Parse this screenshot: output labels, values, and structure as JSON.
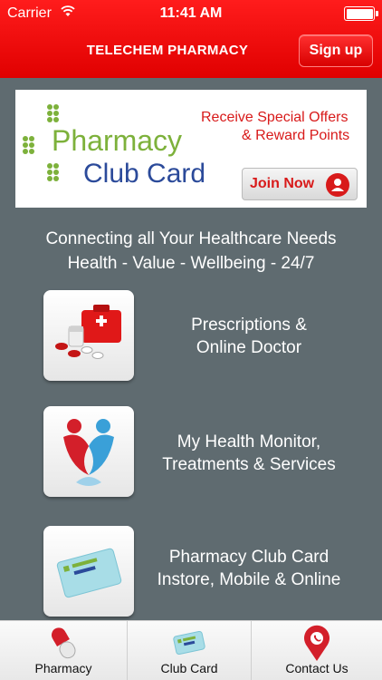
{
  "status_bar": {
    "carrier": "Carrier",
    "time": "11:41 AM"
  },
  "header": {
    "title": "TELECHEM PHARMACY",
    "signup_label": "Sign up"
  },
  "banner": {
    "brand_line1": "Pharmacy",
    "brand_line2": "Club Card",
    "offer_line1": "Receive Special Offers",
    "offer_line2": "& Reward Points",
    "join_label": "Join Now"
  },
  "tagline": {
    "line1": "Connecting all Your Healthcare Needs",
    "line2": "Health - Value - Wellbeing - 24/7"
  },
  "menu": [
    {
      "line1": "Prescriptions &",
      "line2": "Online Doctor",
      "icon": "first-aid-kit-icon"
    },
    {
      "line1": "My Health Monitor,",
      "line2": "Treatments & Services",
      "icon": "health-people-icon"
    },
    {
      "line1": "Pharmacy Club Card",
      "line2": "Instore, Mobile & Online",
      "icon": "club-card-icon"
    }
  ],
  "tabs": [
    {
      "label": "Pharmacy",
      "icon": "pill-icon"
    },
    {
      "label": "Club Card",
      "icon": "club-card-icon"
    },
    {
      "label": "Contact Us",
      "icon": "location-pin-icon"
    }
  ],
  "colors": {
    "brand_red": "#e00000",
    "background": "#5f6b70",
    "brand_green": "#7db13b",
    "brand_blue": "#2b4a9a"
  }
}
